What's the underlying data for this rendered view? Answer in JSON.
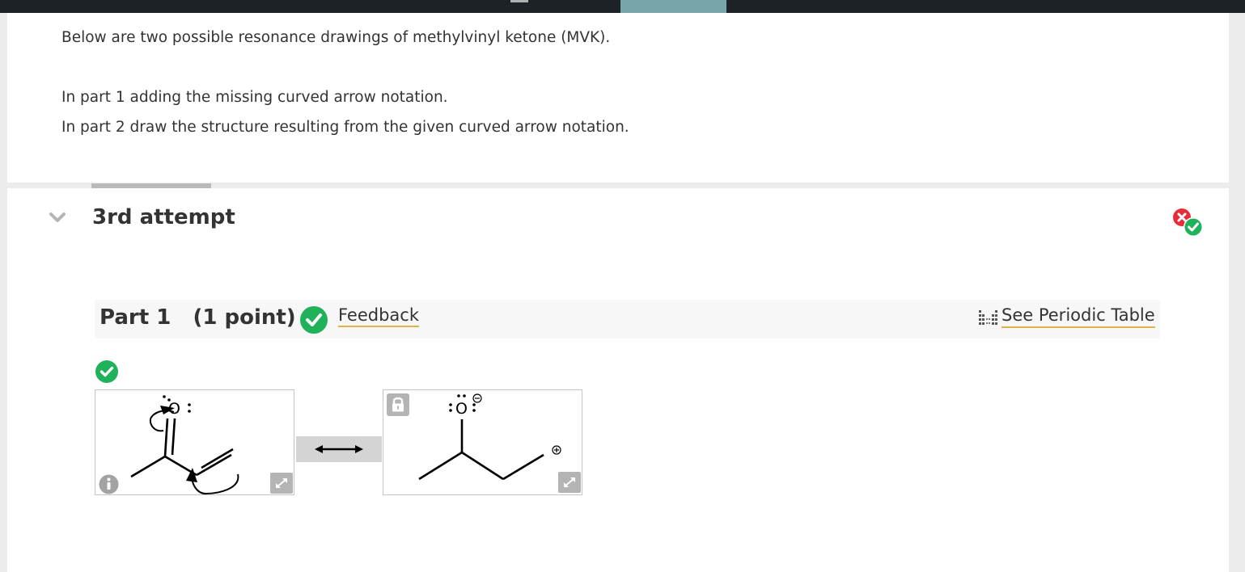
{
  "question": {
    "line1": "Below are two possible resonance drawings of methylvinyl ketone (MVK).",
    "line2": "In part 1 adding the missing curved arrow notation.",
    "line3": "In part 2 draw the structure resulting from the given curved arrow notation."
  },
  "attempt": {
    "title": "3rd attempt"
  },
  "part": {
    "title": "Part 1   (1 point)",
    "feedback_label": "Feedback",
    "periodic_table_label": "See Periodic Table"
  },
  "colors": {
    "correct_green": "#1fb25a",
    "incorrect_red": "#e52e3a",
    "link_underline": "#e0b24a",
    "topbar": "#1d2226",
    "topbar_tab": "#77a6a8"
  }
}
